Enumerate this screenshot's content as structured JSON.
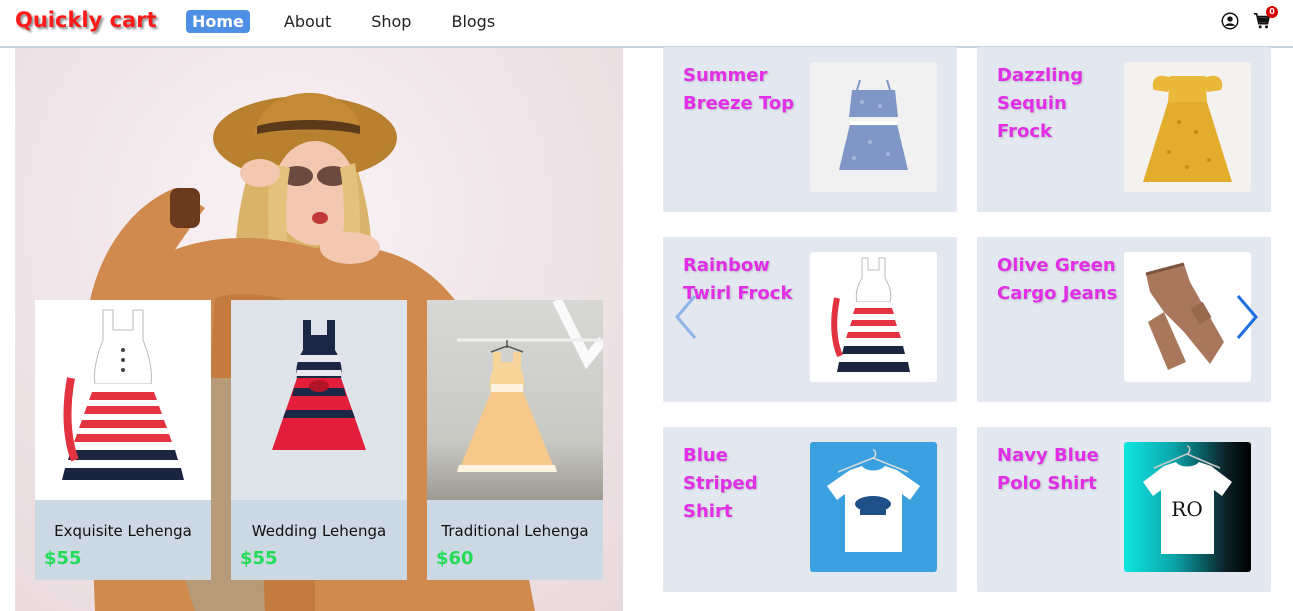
{
  "brand": "Quickly cart",
  "nav": {
    "items": [
      {
        "label": "Home",
        "active": true
      },
      {
        "label": "About"
      },
      {
        "label": "Shop"
      },
      {
        "label": "Blogs"
      }
    ],
    "cart_count": "0",
    "icons": [
      "user-icon",
      "cart-icon"
    ]
  },
  "hero": {
    "cards": [
      {
        "name": "Exquisite Lehenga",
        "price": "$55"
      },
      {
        "name": "Wedding Lehenga",
        "price": "$55"
      },
      {
        "name": "Traditional Lehenga",
        "price": "$60"
      }
    ]
  },
  "products": [
    {
      "title": "Summer Breeze Top"
    },
    {
      "title": "Dazzling Sequin Frock"
    },
    {
      "title": "Rainbow Twirl Frock"
    },
    {
      "title": "Olive Green Cargo Jeans"
    },
    {
      "title": "Blue Striped Shirt"
    },
    {
      "title": "Navy Blue Polo Shirt"
    }
  ],
  "colors": {
    "brand": "#ff1a1a",
    "active_nav": "#4d90e6",
    "product_title": "#e22ee6",
    "price": "#22dd55",
    "card_bg": "#e3e8f0"
  }
}
